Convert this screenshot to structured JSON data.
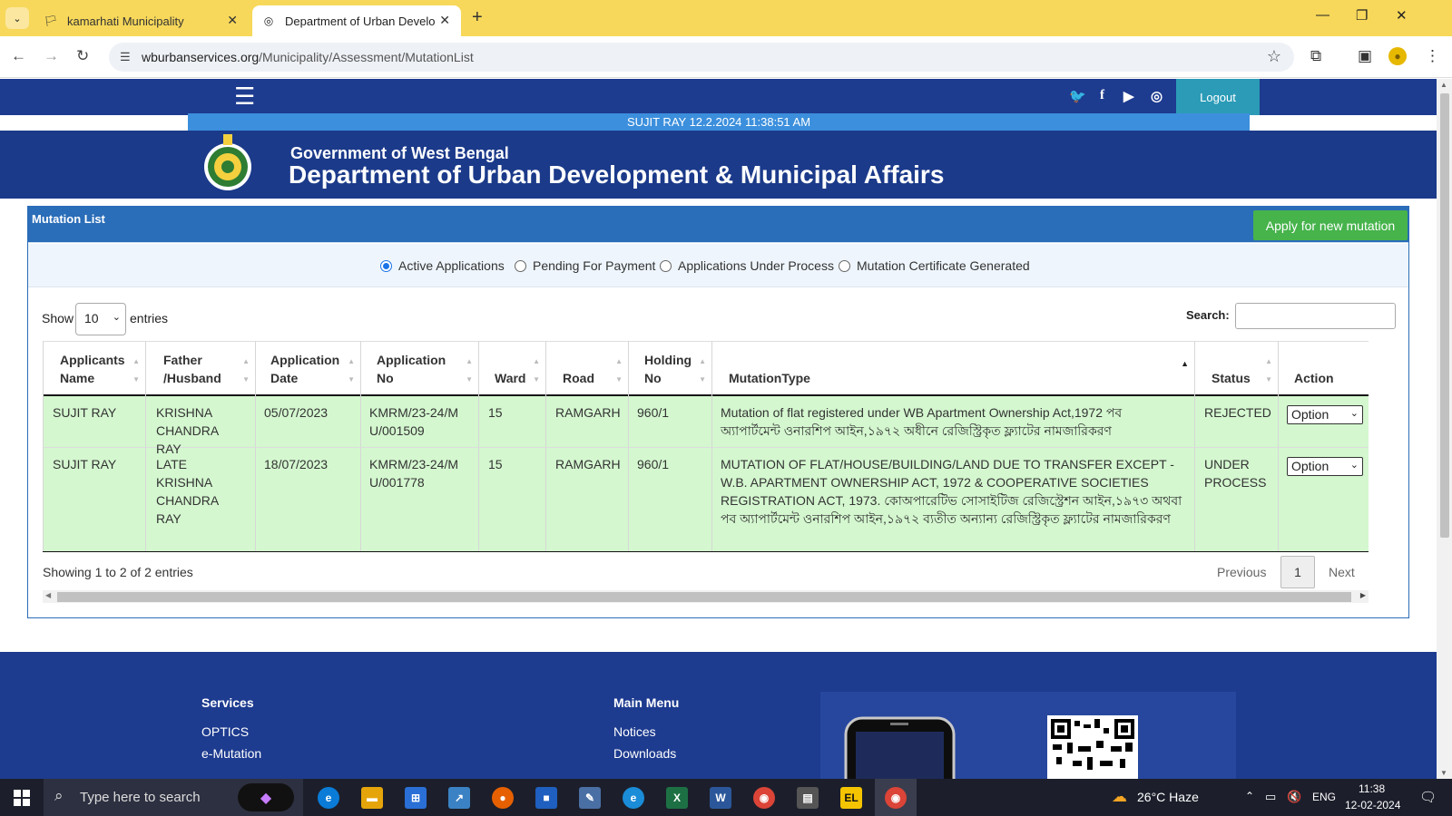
{
  "browser": {
    "tabs": [
      {
        "title": "kamarhati Municipality",
        "active": false
      },
      {
        "title": "Department of Urban Developm",
        "active": true
      }
    ],
    "url_host": "wburbanservices.org",
    "url_path": "/Municipality/Assessment/MutationList"
  },
  "site": {
    "logout_label": "Logout",
    "user_info": "SUJIT RAY  12.2.2024 11:38:51 AM",
    "gov_title": "Government of West Bengal",
    "dept_title": "Department of Urban Development & Municipal Affairs"
  },
  "mutation": {
    "panel_title": "Mutation List",
    "apply_button": "Apply for new mutation",
    "filters": [
      {
        "label": "Active Applications",
        "checked": true
      },
      {
        "label": "Pending For Payment",
        "checked": false
      },
      {
        "label": "Applications Under Process",
        "checked": false
      },
      {
        "label": "Mutation Certificate Generated",
        "checked": false
      }
    ],
    "show_label": "Show",
    "entries_value": "10",
    "entries_label": "entries",
    "search_label": "Search:",
    "columns": [
      "Applicants Name",
      "Father /Husband",
      "Application Date",
      "Application No",
      "Ward",
      "Road",
      "Holding No",
      "MutationType",
      "Status",
      "Action"
    ],
    "rows": [
      {
        "name": "SUJIT RAY",
        "father": "KRISHNA CHANDRA RAY",
        "date": "05/07/2023",
        "app_no": "KMRM/23-24/MU/001509",
        "ward": "15",
        "road": "RAMGARH",
        "holding": "960/1",
        "type": "Mutation of flat registered under WB Apartment Ownership Act,1972 পব অ্যাপার্টমেন্ট ওনারশিপ আইন,১৯৭২ অধীনে রেজিস্ট্রিকৃত ফ্ল্যাটের নামজারিকরণ",
        "status": "REJECTED",
        "action": "Option"
      },
      {
        "name": "SUJIT RAY",
        "father": "LATE KRISHNA CHANDRA RAY",
        "date": "18/07/2023",
        "app_no": "KMRM/23-24/MU/001778",
        "ward": "15",
        "road": "RAMGARH",
        "holding": "960/1",
        "type": "MUTATION OF FLAT/HOUSE/BUILDING/LAND DUE TO TRANSFER EXCEPT - W.B. APARTMENT OWNERSHIP ACT, 1972 & COOPERATIVE SOCIETIES REGISTRATION ACT, 1973. কোঅপারেটিভ সোসাইটিজ রেজিস্ট্রেশন আইন,১৯৭৩ অথবা পব অ্যাপার্টমেন্ট ওনারশিপ আইন,১৯৭২ ব্যতীত অন্যান্য রেজিস্ট্রিকৃত ফ্ল্যাটের নামজারিকরণ",
        "status": "UNDER PROCESS",
        "action": "Option"
      }
    ],
    "info": "Showing 1 to 2 of 2 entries",
    "prev_label": "Previous",
    "page": "1",
    "next_label": "Next"
  },
  "footer": {
    "services_title": "Services",
    "services": [
      "OPTICS",
      "e-Mutation"
    ],
    "menu_title": "Main Menu",
    "menu": [
      "Notices",
      "Downloads"
    ]
  },
  "taskbar": {
    "search_placeholder": "Type here to search",
    "weather": "26°C  Haze",
    "lang": "ENG",
    "time": "11:38",
    "date": "12-02-2024"
  },
  "colors": {
    "nav_blue": "#1d3b8f",
    "row_green": "#d4f7cf",
    "apply_green": "#46b34b",
    "tabstrip_yellow": "#f7d85a"
  }
}
